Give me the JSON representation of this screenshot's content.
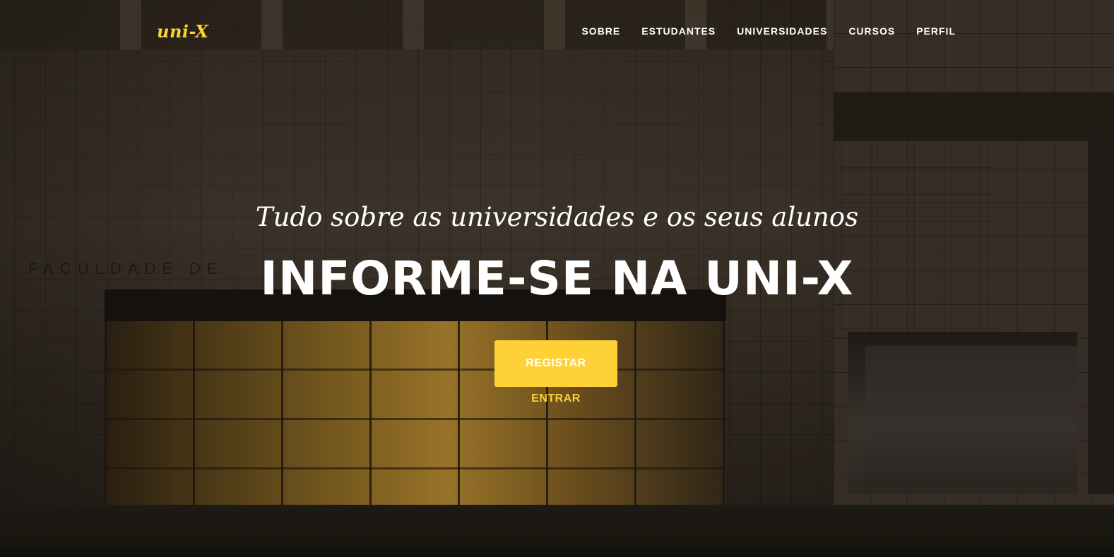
{
  "brand": {
    "name": "uni-X"
  },
  "nav": {
    "items": [
      {
        "label": "SOBRE"
      },
      {
        "label": "ESTUDANTES"
      },
      {
        "label": "UNIVERSIDADES"
      },
      {
        "label": "CURSOS"
      },
      {
        "label": "PERFIL"
      }
    ]
  },
  "hero": {
    "subheading": "Tudo sobre as universidades e os seus alunos",
    "heading": "INFORME-SE NA UNI-X",
    "register_label": "REGISTAR",
    "login_label": "ENTRAR",
    "background_lettering": "FACULDADE DE"
  },
  "colors": {
    "accent": "#fed136",
    "text": "#ffffff"
  }
}
